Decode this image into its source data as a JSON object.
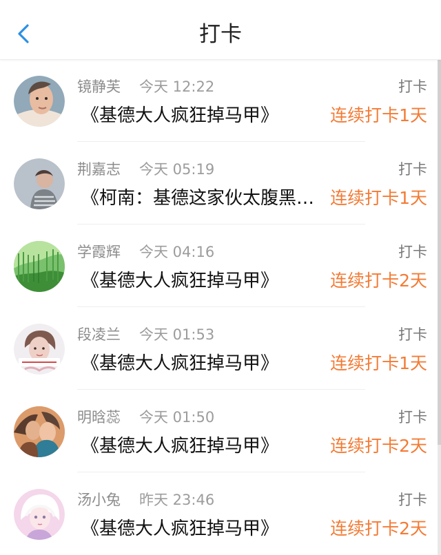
{
  "header": {
    "title": "打卡"
  },
  "colors": {
    "accent": "#f37b35",
    "back": "#2c8fe6",
    "name": "#8c8c8c",
    "text": "#111111"
  },
  "records": [
    {
      "avatar": "portrait-avatar",
      "name": "镜静芙",
      "time": "今天 12:22",
      "status": "打卡",
      "book": "《基德大人疯狂掉马甲》",
      "streak": "连续打卡1天"
    },
    {
      "avatar": "portrait-avatar",
      "name": "荆嘉志",
      "time": "今天 05:19",
      "status": "打卡",
      "book": "《柯南：基德这家伙太腹黑…",
      "streak": "连续打卡1天"
    },
    {
      "avatar": "forest-avatar",
      "name": "学霞辉",
      "time": "今天 04:16",
      "status": "打卡",
      "book": "《基德大人疯狂掉马甲》",
      "streak": "连续打卡2天"
    },
    {
      "avatar": "portrait-avatar",
      "name": "段凌兰",
      "time": "今天 01:53",
      "status": "打卡",
      "book": "《基德大人疯狂掉马甲》",
      "streak": "连续打卡1天"
    },
    {
      "avatar": "couple-avatar",
      "name": "明晗蕊",
      "time": "今天 01:50",
      "status": "打卡",
      "book": "《基德大人疯狂掉马甲》",
      "streak": "连续打卡2天"
    },
    {
      "avatar": "anime-avatar",
      "name": "汤小兔",
      "time": "昨天 23:46",
      "status": "打卡",
      "book": "《基德大人疯狂掉马甲》",
      "streak": "连续打卡2天"
    }
  ]
}
